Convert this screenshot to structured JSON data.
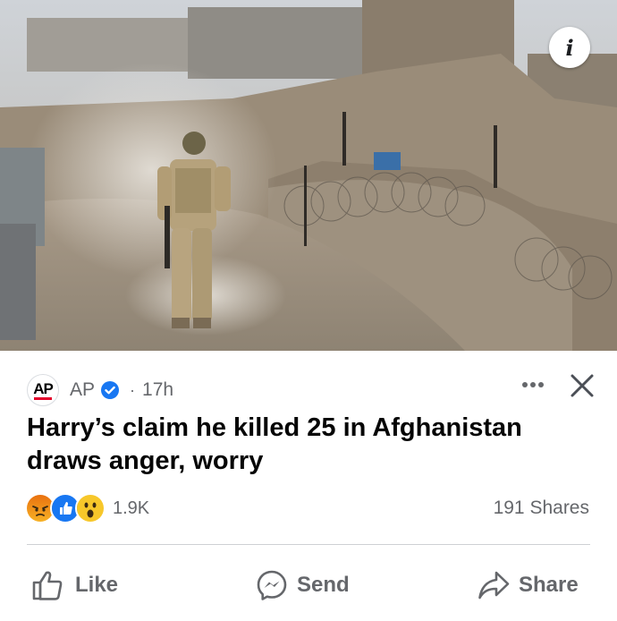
{
  "post": {
    "source": {
      "avatar_text": "AP",
      "name": "AP",
      "separator": "·",
      "time": "17h"
    },
    "headline": "Harry’s claim he killed 25 in Afghanistan draws anger, worry",
    "info_label": "i",
    "reactions": {
      "icons": [
        "angry-reaction",
        "like-reaction",
        "wow-reaction"
      ],
      "count": "1.9K"
    },
    "shares": "191 Shares",
    "actions": {
      "like": "Like",
      "send": "Send",
      "share": "Share"
    },
    "colors": {
      "verified_blue": "#1877f2",
      "secondary_text": "#65676b",
      "ap_red": "#e4002b"
    }
  }
}
